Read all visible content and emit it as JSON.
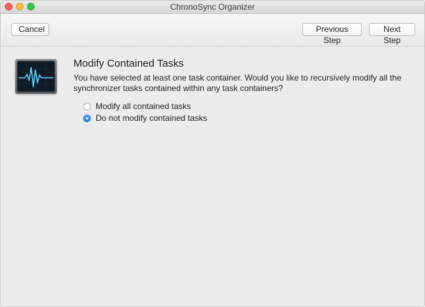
{
  "window": {
    "title": "ChronoSync Organizer"
  },
  "toolbar": {
    "cancel_label": "Cancel",
    "previous_label": "Previous Step",
    "next_label": "Next Step"
  },
  "content": {
    "app_icon": "activity-monitor-icon",
    "heading": "Modify Contained Tasks",
    "description": "You have selected at least one task container. Would you like to recursively modify all the synchronizer tasks contained within any task containers?",
    "options": [
      {
        "label": "Modify all contained tasks",
        "selected": false
      },
      {
        "label": "Do not modify contained tasks",
        "selected": true
      }
    ]
  },
  "colors": {
    "accent": "#2b80ec",
    "close": "#fc605c",
    "minimize": "#fdbc40",
    "zoom": "#34c84a"
  }
}
